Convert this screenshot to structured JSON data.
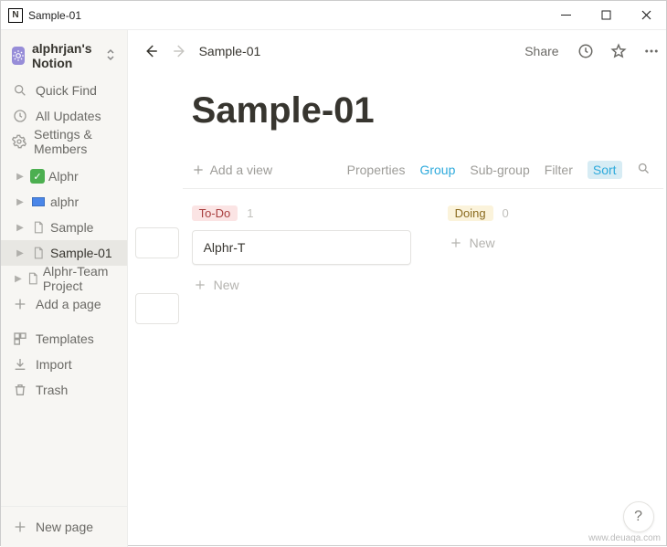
{
  "window": {
    "app_glyph": "N",
    "title": "Sample-01"
  },
  "workspace": {
    "name": "alphrjan's Notion"
  },
  "sidebar": {
    "quick_find": "Quick Find",
    "all_updates": "All Updates",
    "settings": "Settings & Members",
    "pages": [
      {
        "label": "Alphr",
        "icon": "green-check"
      },
      {
        "label": "alphr",
        "icon": "blue-box"
      },
      {
        "label": "Sample",
        "icon": "doc"
      },
      {
        "label": "Sample-01",
        "icon": "doc",
        "selected": true
      },
      {
        "label": "Alphr-Team Project",
        "icon": "doc"
      }
    ],
    "add_page_inline": "Add a page",
    "templates": "Templates",
    "import": "Import",
    "trash": "Trash",
    "new_page": "New page"
  },
  "topbar": {
    "breadcrumb": "Sample-01",
    "share": "Share"
  },
  "page": {
    "title": "Sample-01"
  },
  "view_controls": {
    "add_view": "Add a view",
    "properties": "Properties",
    "group": "Group",
    "subgroup": "Sub-group",
    "filter": "Filter",
    "sort": "Sort"
  },
  "board": {
    "columns": [
      {
        "name": "To-Do",
        "tag_class": "todo",
        "count": "1",
        "cards": [
          {
            "title": "Alphr-T"
          }
        ],
        "new_label": "New"
      },
      {
        "name": "Doing",
        "tag_class": "doing",
        "count": "0",
        "cards": [],
        "new_label": "New"
      }
    ]
  },
  "help": "?",
  "watermark": "www.deuaqa.com"
}
